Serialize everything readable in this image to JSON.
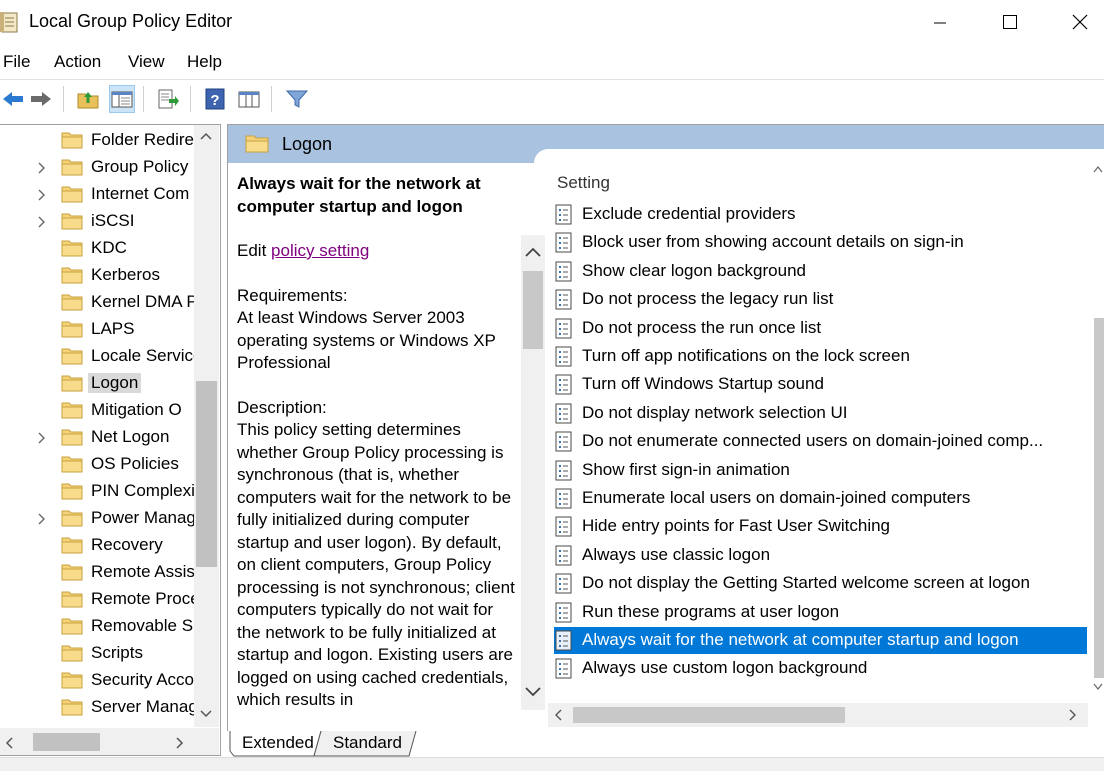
{
  "window": {
    "title": "Local Group Policy Editor"
  },
  "menu": [
    "File",
    "Action",
    "View",
    "Help"
  ],
  "toolbar": {
    "buttons": [
      "back-arrow-icon",
      "forward-arrow-icon",
      "folder-up-icon",
      "show-hide-tree-icon",
      "export-list-icon",
      "help-icon",
      "properties-view-icon",
      "filter-icon"
    ]
  },
  "tree": {
    "items": [
      {
        "label": "Folder Redire",
        "expandable": false
      },
      {
        "label": "Group Policy",
        "expandable": true
      },
      {
        "label": "Internet Com",
        "expandable": true
      },
      {
        "label": "iSCSI",
        "expandable": true
      },
      {
        "label": "KDC",
        "expandable": false
      },
      {
        "label": "Kerberos",
        "expandable": false
      },
      {
        "label": "Kernel DMA P",
        "expandable": false
      },
      {
        "label": "LAPS",
        "expandable": false
      },
      {
        "label": "Locale Service",
        "expandable": false
      },
      {
        "label": "Logon",
        "expandable": false,
        "selected": true
      },
      {
        "label": "Mitigation O",
        "expandable": false
      },
      {
        "label": "Net Logon",
        "expandable": true
      },
      {
        "label": "OS Policies",
        "expandable": false
      },
      {
        "label": "PIN Complexi",
        "expandable": false
      },
      {
        "label": "Power Manag",
        "expandable": true
      },
      {
        "label": "Recovery",
        "expandable": false
      },
      {
        "label": "Remote Assis",
        "expandable": false
      },
      {
        "label": "Remote Proce",
        "expandable": false
      },
      {
        "label": "Removable S",
        "expandable": false
      },
      {
        "label": "Scripts",
        "expandable": false
      },
      {
        "label": "Security Acco",
        "expandable": false
      },
      {
        "label": "Server Manag",
        "expandable": false
      }
    ]
  },
  "pane": {
    "title": "Logon",
    "description": {
      "title": "Always wait for the network at computer startup and logon",
      "edit_prefix": "Edit ",
      "edit_link": "policy setting ",
      "requirements_label": "Requirements:",
      "requirements": "At least Windows Server 2003 operating systems or Windows XP Professional",
      "description_label": "Description:",
      "description": "This policy setting determines whether Group Policy processing is synchronous (that is, whether computers wait for the network to be fully initialized during computer startup and user logon). By default, on client computers, Group Policy processing is not synchronous; client computers typically do not wait for the network to be fully initialized at startup and logon. Existing users are logged on using cached credentials, which results in"
    },
    "column_header": "Setting",
    "settings": [
      "Exclude credential providers",
      "Block user from showing account details on sign-in",
      "Show clear logon background",
      "Do not process the legacy run list",
      "Do not process the run once list",
      "Turn off app notifications on the lock screen",
      "Turn off Windows Startup sound",
      "Do not display network selection UI",
      "Do not enumerate connected users on domain-joined comp...",
      "Show first sign-in animation",
      "Enumerate local users on domain-joined computers",
      "Hide entry points for Fast User Switching",
      "Always use classic logon",
      "Do not display the Getting Started welcome screen at logon",
      "Run these programs at user logon",
      "Always wait for the network at computer startup and logon",
      "Always use custom logon background"
    ],
    "selected_index": 15
  },
  "tabs": [
    "Extended",
    "Standard"
  ],
  "colors": {
    "selection": "#0078d7",
    "header": "#a9c2df",
    "link": "#800080"
  }
}
